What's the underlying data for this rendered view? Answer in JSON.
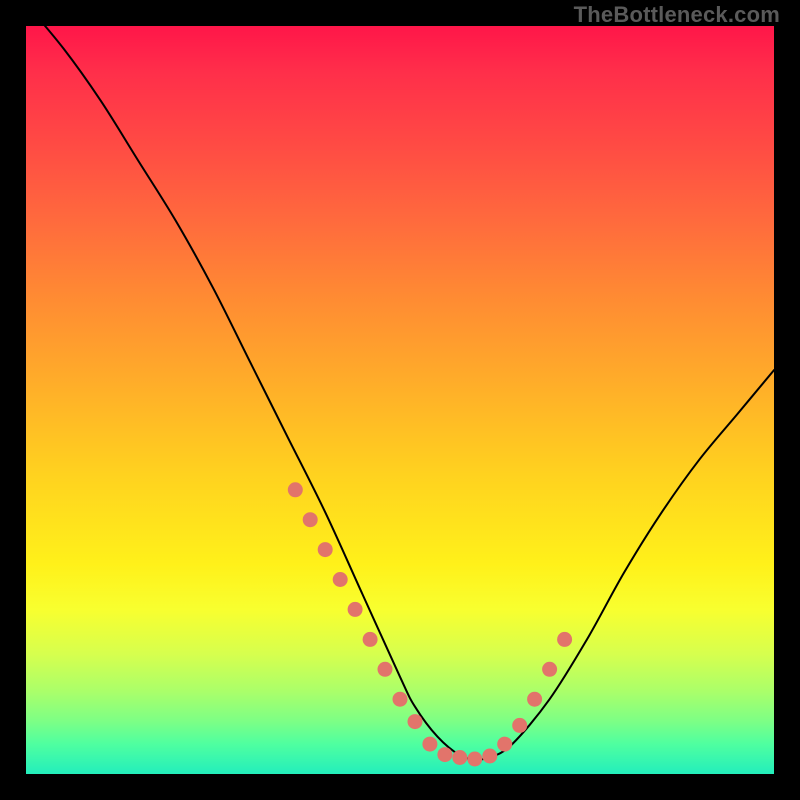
{
  "watermark": "TheBottleneck.com",
  "colors": {
    "border": "#000000",
    "curve": "#000000",
    "dots": "#e2746b",
    "gradient_top": "#ff1649",
    "gradient_bottom": "#23eebc"
  },
  "chart_data": {
    "type": "line",
    "title": "",
    "xlabel": "",
    "ylabel": "",
    "xlim": [
      0,
      100
    ],
    "ylim": [
      0,
      100
    ],
    "grid": false,
    "legend": false,
    "series": [
      {
        "name": "bottleneck-curve",
        "x": [
          0,
          5,
          10,
          15,
          20,
          25,
          30,
          35,
          40,
          45,
          50,
          52,
          55,
          58,
          60,
          62,
          65,
          70,
          75,
          80,
          85,
          90,
          95,
          100
        ],
        "y": [
          103,
          97,
          90,
          82,
          74,
          65,
          55,
          45,
          35,
          24,
          13,
          9,
          5,
          2.5,
          2,
          2.2,
          4,
          10,
          18,
          27,
          35,
          42,
          48,
          54
        ]
      }
    ],
    "highlight_points": {
      "name": "curve-highlight-dots",
      "x": [
        36,
        38,
        40,
        42,
        44,
        46,
        48,
        50,
        52,
        54,
        56,
        58,
        60,
        62,
        64,
        66,
        68,
        70,
        72
      ],
      "y": [
        38,
        34,
        30,
        26,
        22,
        18,
        14,
        10,
        7,
        4,
        2.6,
        2.2,
        2,
        2.4,
        4,
        6.5,
        10,
        14,
        18
      ]
    }
  }
}
